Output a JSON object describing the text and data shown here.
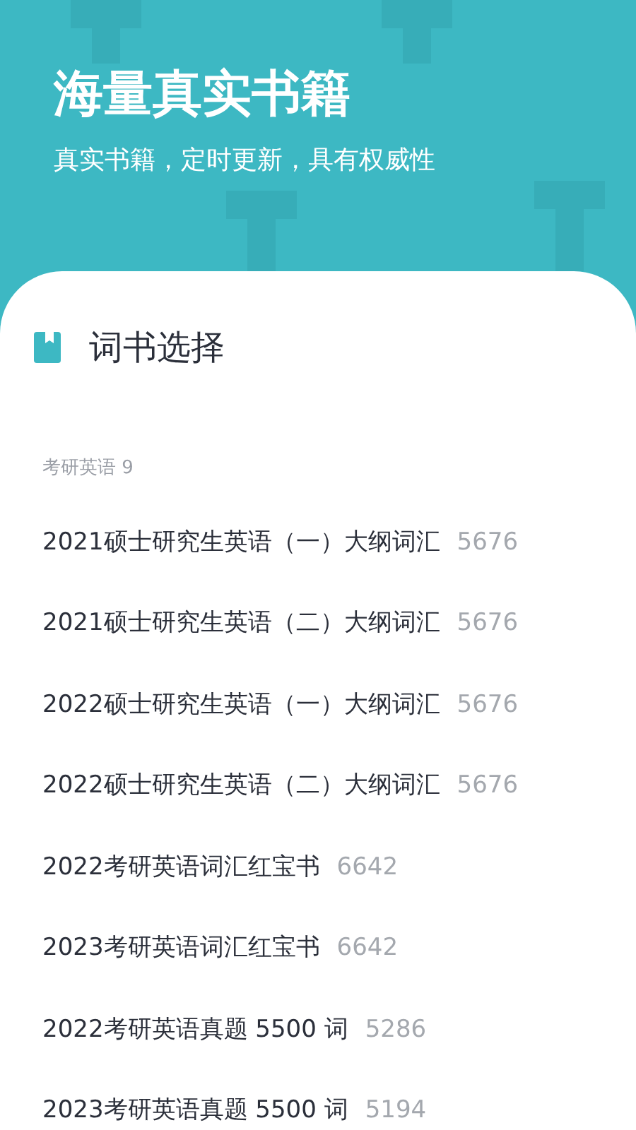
{
  "banner": {
    "title": "海量真实书籍",
    "subtitle": "真实书籍，定时更新，具有权威性"
  },
  "panel": {
    "heading": "词书选择",
    "category": "考研英语 9",
    "books": [
      {
        "name": "2021硕士研究生英语（一）大纲词汇",
        "count": "5676"
      },
      {
        "name": "2021硕士研究生英语（二）大纲词汇",
        "count": "5676"
      },
      {
        "name": "2022硕士研究生英语（一）大纲词汇",
        "count": "5676"
      },
      {
        "name": "2022硕士研究生英语（二）大纲词汇",
        "count": "5676"
      },
      {
        "name": "2022考研英语词汇红宝书",
        "count": "6642"
      },
      {
        "name": "2023考研英语词汇红宝书",
        "count": "6642"
      },
      {
        "name": "2022考研英语真题 5500 词",
        "count": "5286"
      },
      {
        "name": "2023考研英语真题 5500 词",
        "count": "5194"
      }
    ]
  }
}
